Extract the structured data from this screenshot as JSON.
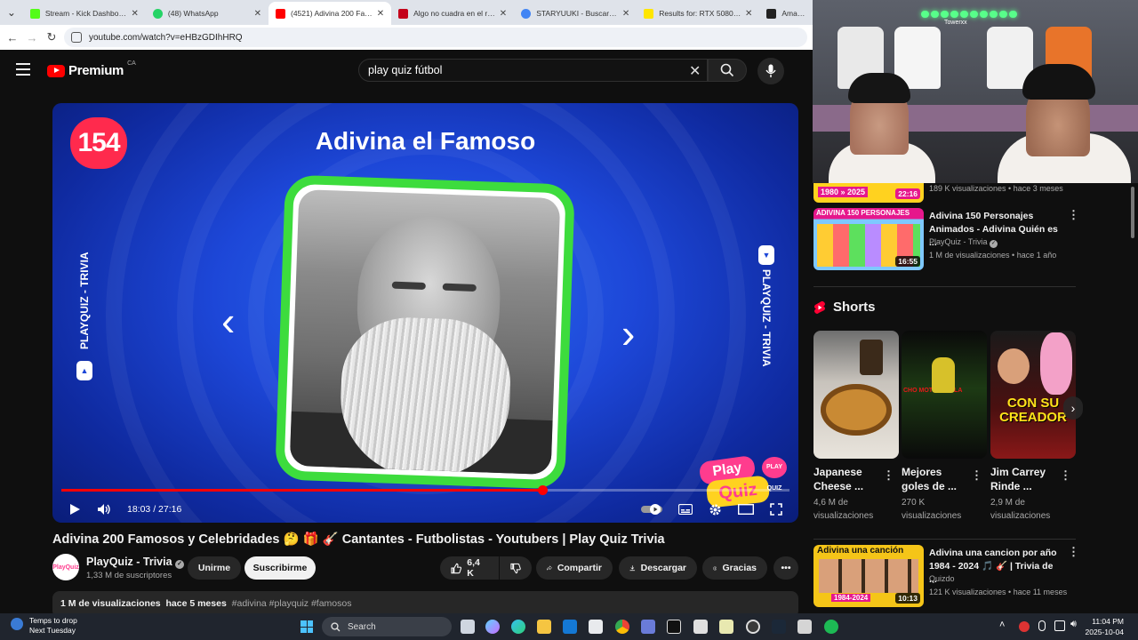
{
  "browser": {
    "tabs": [
      {
        "title": "Stream - Kick Dashboard",
        "color": "#53fc18",
        "active": false
      },
      {
        "title": "(48) WhatsApp",
        "color": "#25d366",
        "active": false
      },
      {
        "title": "(4521) Adivina 200 Famosos",
        "color": "#ff0000",
        "active": true
      },
      {
        "title": "Algo no cuadra en el relato",
        "color": "#c4001a",
        "active": false
      },
      {
        "title": "STARYUUKI - Buscar con Google",
        "color": "#4285f4",
        "active": false
      },
      {
        "title": "Results for: RTX 5080 | Best",
        "color": "#ffe600",
        "active": false
      },
      {
        "title": "Amazon.ca",
        "color": "#222222",
        "active": false
      }
    ],
    "url": "youtube.com/watch?v=eHBzGDIhHRQ"
  },
  "youtube": {
    "logo_text": "Premium",
    "region": "CA",
    "search_query": "play quiz fútbol"
  },
  "player": {
    "badge_number": "154",
    "video_overlay_title": "Adivina el Famoso",
    "side_label": "PLAYQUIZ - TRIVIA",
    "watermark_top": "Play",
    "watermark_bottom": "Quiz",
    "watermark_badge": "PLAY QUIZ",
    "time": "18:03 / 27:16",
    "progress": 0.661
  },
  "video": {
    "title": "Adivina 200 Famosos y Celebridades 🤔 🎁 🎸 Cantantes - Futbolistas - Youtubers | Play Quiz Trivia",
    "channel": "PlayQuiz - Trivia",
    "subscribers": "1,33 M de suscriptores",
    "avatar_text": "PlayQuiz",
    "join_label": "Unirme",
    "subscribe_label": "Suscribirme",
    "likes": "6,4 K",
    "share_label": "Compartir",
    "download_label": "Descargar",
    "thanks_label": "Gracias",
    "views": "1 M de visualizaciones",
    "published": "hace 5 meses",
    "tags": "#adivina #playquiz #famosos"
  },
  "related": [
    {
      "thumb_text": "1980 » 2025",
      "duration": "22:16",
      "title": "",
      "channel": "",
      "meta": "189 K visualizaciones • hace 3 meses",
      "thumb_bg": "#ffd21f"
    },
    {
      "thumb_text": "ADIVINA 150 PERSONAJES",
      "duration": "16:55",
      "title": "Adivina 150 Personajes Animados - Adivina Quién es ...",
      "channel": "PlayQuiz - Trivia",
      "meta": "1 M de visualizaciones • hace 1 año",
      "thumb_bg": "#e6178c"
    },
    {
      "thumb_text": "Adivina una canción",
      "thumb_sub": "1984-2024",
      "duration": "10:13",
      "title": "Adivina una cancion por año 1984 - 2024 🎵 🎸 | Trivia de ...",
      "channel": "Quizdo",
      "meta": "121 K visualizaciones • hace 11 meses",
      "thumb_bg": "#f5c518"
    }
  ],
  "shorts": {
    "heading": "Shorts",
    "items": [
      {
        "title": "Japanese Cheese ...",
        "views": "4,6 M de visualizaciones",
        "thumb_text": ""
      },
      {
        "title": "Mejores goles de ...",
        "views": "270 K visualizaciones",
        "thumb_text": "CHO MOTOR DE LA"
      },
      {
        "title": "Jim Carrey Rinde ...",
        "views": "2,9 M de visualizaciones",
        "thumb_text": "CON SU CREADOR"
      }
    ]
  },
  "webcam": {
    "led_label": "Towerxx"
  },
  "taskbar": {
    "weather_line1": "Temps to drop",
    "weather_line2": "Next Tuesday",
    "search_label": "Search",
    "time": "11:04 PM",
    "date": "2025-10-04"
  }
}
